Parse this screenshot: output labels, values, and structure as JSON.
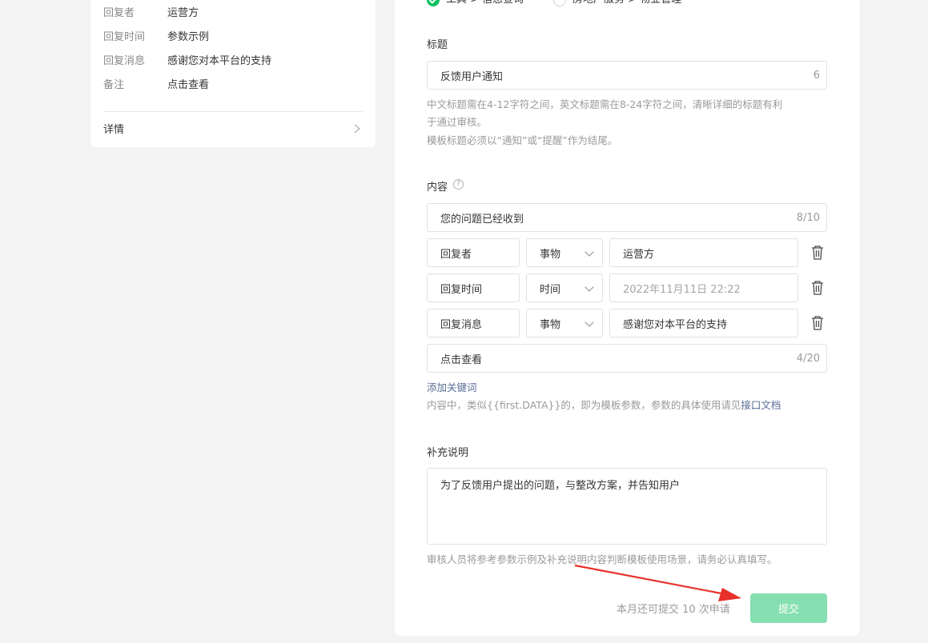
{
  "preview": {
    "rows": [
      {
        "key": "回复者",
        "value": "运营方"
      },
      {
        "key": "回复时间",
        "value": "参数示例"
      },
      {
        "key": "回复消息",
        "value": "感谢您对本平台的支持"
      },
      {
        "key": "备注",
        "value": "点击查看"
      }
    ],
    "details_label": "详情"
  },
  "category": {
    "options": [
      {
        "label": "工具 > 信息查询",
        "selected": true
      },
      {
        "label": "房地产服务 > 物业管理",
        "selected": false
      }
    ]
  },
  "title_field": {
    "label": "标题",
    "value": "反馈用户通知",
    "count": "6",
    "hint_line1": "中文标题需在4-12字符之间，英文标题需在8-24字符之间，清晰详细的标题有利",
    "hint_line2": "于通过审核。",
    "hint_line3": "模板标题必须以“通知”或“提醒”作为结尾。"
  },
  "content_field": {
    "label": "内容",
    "help": "?",
    "first": {
      "value": "您的问题已经收到",
      "count": "8/10"
    },
    "keywords": [
      {
        "name": "回复者",
        "type": "事物",
        "value": "运营方",
        "placeholder": ""
      },
      {
        "name": "回复时间",
        "type": "时间",
        "value": "",
        "placeholder": "2022年11月11日 22:22"
      },
      {
        "name": "回复消息",
        "type": "事物",
        "value": "感谢您对本平台的支持",
        "placeholder": ""
      }
    ],
    "remark": {
      "value": "点击查看",
      "count": "4/20"
    },
    "add_keyword": "添加关键词",
    "hint_prefix": "内容中，类似{{first.DATA}}的，即为模板参数，参数的具体使用请见",
    "hint_link": "接口文档"
  },
  "supplement": {
    "label": "补充说明",
    "value": "为了反馈用户提出的问题，与整改方案，并告知用户",
    "hint": "审核人员将参考参数示例及补充说明内容判断模板使用场景，请务必认真填写。"
  },
  "footer": {
    "quota": "本月还可提交 10 次申请",
    "submit": "提交"
  },
  "colors": {
    "brand_green": "#07c160",
    "submit_disabled": "#86dfb0",
    "link": "#576b95",
    "annotation_arrow": "#e8312a"
  }
}
